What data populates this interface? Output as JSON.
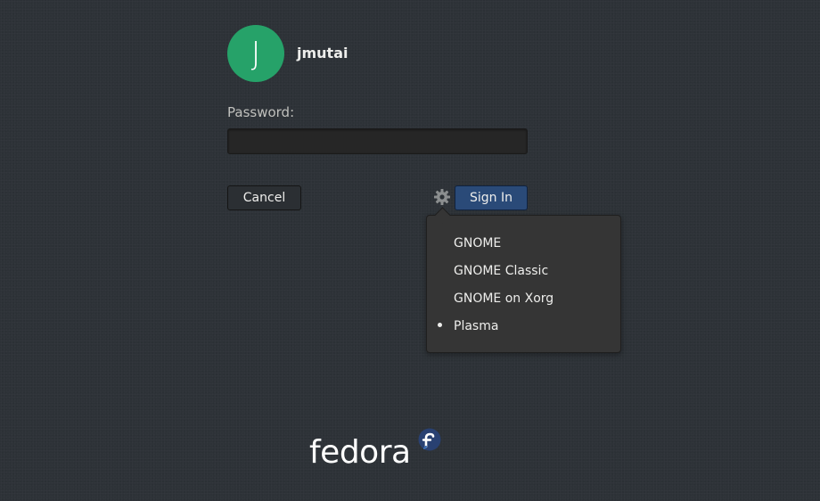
{
  "user": {
    "avatar_initial": "J",
    "avatar_color": "#26a269",
    "username": "jmutai"
  },
  "login": {
    "password_label": "Password:",
    "password_value": "",
    "cancel_label": "Cancel",
    "signin_label": "Sign In",
    "session_icon": "gear-icon"
  },
  "session_menu": {
    "items": [
      {
        "label": "GNOME",
        "selected": false
      },
      {
        "label": "GNOME Classic",
        "selected": false
      },
      {
        "label": "GNOME on Xorg",
        "selected": false
      },
      {
        "label": "Plasma",
        "selected": true
      }
    ]
  },
  "branding": {
    "logo_text": "fedora",
    "logo_mark": "fedora-infinity-icon",
    "accent": "#294172"
  }
}
